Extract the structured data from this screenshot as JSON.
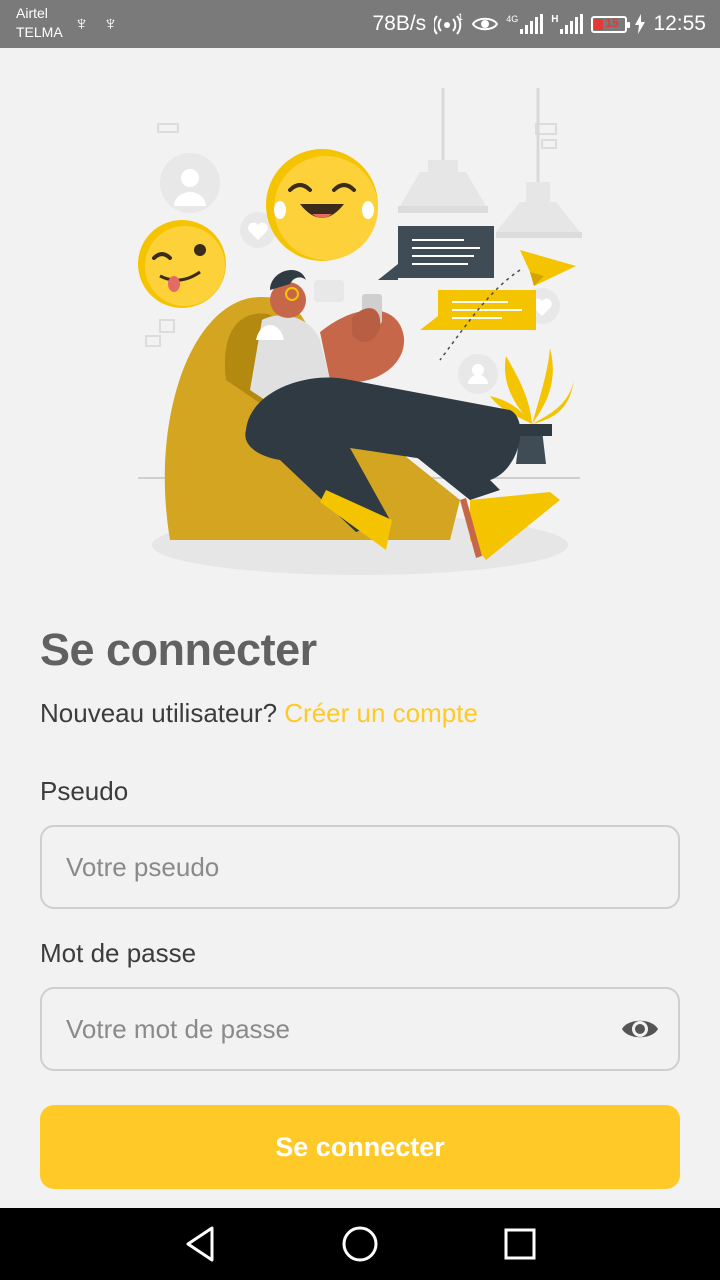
{
  "status_bar": {
    "carrier_1": "Airtel",
    "carrier_2": "TELMA",
    "net_speed": "78B/s",
    "signal_1_label": "4G",
    "signal_2_label": "H",
    "battery_level": "15",
    "time": "12:55"
  },
  "login": {
    "title": "Se connecter",
    "new_user_text": "Nouveau utilisateur?",
    "create_account_link": "Créer un compte",
    "pseudo_label": "Pseudo",
    "pseudo_placeholder": "Votre pseudo",
    "password_label": "Mot de passe",
    "password_placeholder": "Votre mot de passe",
    "submit_label": "Se connecter"
  },
  "colors": {
    "accent": "#ffc927",
    "title": "#616161",
    "text": "#3c3c3c",
    "background": "#f2f2f2"
  },
  "icons": {
    "usb": "usb-icon",
    "hotspot": "hotspot-icon",
    "eye_care": "eye-icon",
    "password_toggle": "visibility-icon",
    "nav_back": "back-triangle-icon",
    "nav_home": "home-circle-icon",
    "nav_recents": "recents-square-icon"
  }
}
